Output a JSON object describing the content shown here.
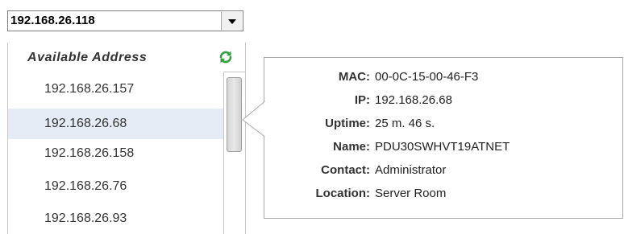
{
  "selector": {
    "selected_value": "192.168.26.118"
  },
  "dropdown": {
    "header": "Available Address",
    "items": [
      {
        "label": "192.168.26.157"
      },
      {
        "label": "192.168.26.68"
      },
      {
        "label": "192.168.26.158"
      },
      {
        "label": "192.168.26.76"
      },
      {
        "label": "192.168.26.93"
      }
    ],
    "selected_label": "192.168.26.68"
  },
  "tooltip": {
    "rows": [
      {
        "label": "MAC:",
        "value": "00-0C-15-00-46-F3"
      },
      {
        "label": "IP:",
        "value": "192.168.26.68"
      },
      {
        "label": "Uptime:",
        "value": "25 m. 46 s."
      },
      {
        "label": "Name:",
        "value": "PDU30SWHVT19ATNET"
      },
      {
        "label": "Contact:",
        "value": "Administrator"
      },
      {
        "label": "Location:",
        "value": "Server Room"
      }
    ]
  },
  "colors": {
    "refresh_icon": "#2e9e3e",
    "selected_row_bg": "#e5ecf6",
    "tooltip_border": "#a9a9a9"
  },
  "icons": {
    "combo_button": "chevron-down-icon",
    "refresh": "refresh-icon"
  }
}
